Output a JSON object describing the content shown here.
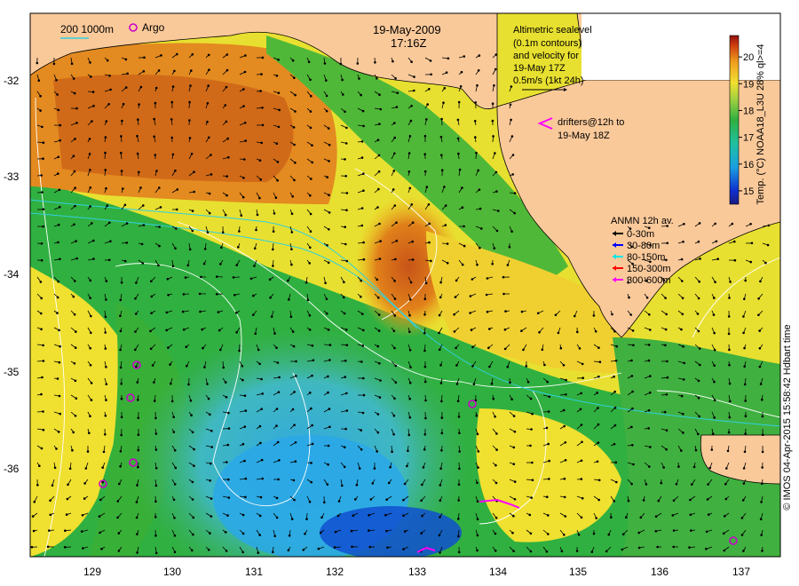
{
  "map": {
    "title_date": "19-May-2009",
    "title_time": "17:16Z",
    "scale_label": "200  1000m",
    "argo_label": "Argo",
    "altimetry_lines": [
      "Altimetric sealevel",
      "(0.1m contours)",
      "and velocity for",
      "19-May 17Z",
      "0.5m/s (1kt 24h)"
    ],
    "drifters_lines": [
      "drifters@12h to",
      "19-May 18Z"
    ],
    "anmn_title": "ANMN 12h av.",
    "anmn_legend": [
      {
        "label": "0-30m",
        "color": "#000000"
      },
      {
        "label": "30-80m",
        "color": "#0000ff"
      },
      {
        "label": "80-150m",
        "color": "#00e5e5"
      },
      {
        "label": "150-300m",
        "color": "#ff0000"
      },
      {
        "label": "300-600m",
        "color": "#ff00ff"
      }
    ],
    "colorbar": {
      "ticks": [
        "15",
        "16",
        "17",
        "18",
        "19",
        "20"
      ],
      "title": "Temp. (°C) NOAA18_L3U 28% ql>=4",
      "min": 14.5,
      "max": 20.8
    },
    "x_ticks": [
      "129",
      "130",
      "131",
      "132",
      "133",
      "134",
      "135",
      "136",
      "137"
    ],
    "y_ticks": [
      "-32",
      "-33",
      "-34",
      "-35",
      "-36"
    ],
    "credit": "© IMOS 04-Apr-2015 15:58:42 Hdbart time",
    "colors": {
      "land": "#fac99a",
      "warm": "#e0741a",
      "yellow": "#f0e030",
      "green": "#30b040",
      "cyan": "#40b0e0",
      "argo": "#cc00cc"
    }
  }
}
